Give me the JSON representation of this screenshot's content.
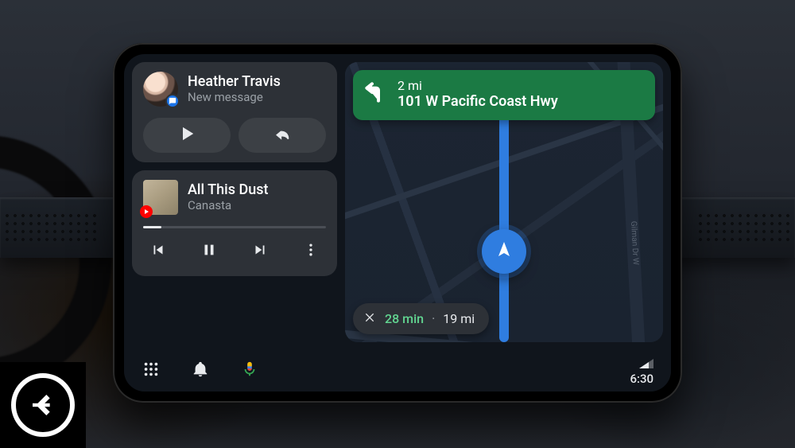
{
  "message": {
    "sender": "Heather Travis",
    "subtitle": "New message",
    "play_label": "Play message",
    "reply_label": "Reply"
  },
  "music": {
    "title": "All This Dust",
    "artist": "Canasta",
    "progress_pct": 10
  },
  "nav": {
    "distance": "2 mi",
    "road": "101 W Pacific Coast Hwy",
    "map_street_label": "Gilman Dr W"
  },
  "eta": {
    "time": "28 min",
    "distance": "19 mi"
  },
  "status": {
    "clock": "6:30"
  },
  "icons": {
    "apps": "apps-grid-icon",
    "notifications": "bell-icon",
    "assistant": "mic-icon",
    "signal": "signal-icon"
  }
}
